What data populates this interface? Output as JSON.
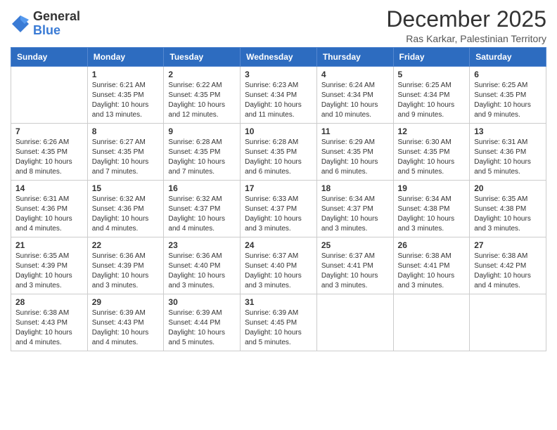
{
  "logo": {
    "general": "General",
    "blue": "Blue"
  },
  "title": "December 2025",
  "location": "Ras Karkar, Palestinian Territory",
  "days_of_week": [
    "Sunday",
    "Monday",
    "Tuesday",
    "Wednesday",
    "Thursday",
    "Friday",
    "Saturday"
  ],
  "weeks": [
    [
      {
        "day": "",
        "info": ""
      },
      {
        "day": "1",
        "info": "Sunrise: 6:21 AM\nSunset: 4:35 PM\nDaylight: 10 hours\nand 13 minutes."
      },
      {
        "day": "2",
        "info": "Sunrise: 6:22 AM\nSunset: 4:35 PM\nDaylight: 10 hours\nand 12 minutes."
      },
      {
        "day": "3",
        "info": "Sunrise: 6:23 AM\nSunset: 4:34 PM\nDaylight: 10 hours\nand 11 minutes."
      },
      {
        "day": "4",
        "info": "Sunrise: 6:24 AM\nSunset: 4:34 PM\nDaylight: 10 hours\nand 10 minutes."
      },
      {
        "day": "5",
        "info": "Sunrise: 6:25 AM\nSunset: 4:34 PM\nDaylight: 10 hours\nand 9 minutes."
      },
      {
        "day": "6",
        "info": "Sunrise: 6:25 AM\nSunset: 4:35 PM\nDaylight: 10 hours\nand 9 minutes."
      }
    ],
    [
      {
        "day": "7",
        "info": "Sunrise: 6:26 AM\nSunset: 4:35 PM\nDaylight: 10 hours\nand 8 minutes."
      },
      {
        "day": "8",
        "info": "Sunrise: 6:27 AM\nSunset: 4:35 PM\nDaylight: 10 hours\nand 7 minutes."
      },
      {
        "day": "9",
        "info": "Sunrise: 6:28 AM\nSunset: 4:35 PM\nDaylight: 10 hours\nand 7 minutes."
      },
      {
        "day": "10",
        "info": "Sunrise: 6:28 AM\nSunset: 4:35 PM\nDaylight: 10 hours\nand 6 minutes."
      },
      {
        "day": "11",
        "info": "Sunrise: 6:29 AM\nSunset: 4:35 PM\nDaylight: 10 hours\nand 6 minutes."
      },
      {
        "day": "12",
        "info": "Sunrise: 6:30 AM\nSunset: 4:35 PM\nDaylight: 10 hours\nand 5 minutes."
      },
      {
        "day": "13",
        "info": "Sunrise: 6:31 AM\nSunset: 4:36 PM\nDaylight: 10 hours\nand 5 minutes."
      }
    ],
    [
      {
        "day": "14",
        "info": "Sunrise: 6:31 AM\nSunset: 4:36 PM\nDaylight: 10 hours\nand 4 minutes."
      },
      {
        "day": "15",
        "info": "Sunrise: 6:32 AM\nSunset: 4:36 PM\nDaylight: 10 hours\nand 4 minutes."
      },
      {
        "day": "16",
        "info": "Sunrise: 6:32 AM\nSunset: 4:37 PM\nDaylight: 10 hours\nand 4 minutes."
      },
      {
        "day": "17",
        "info": "Sunrise: 6:33 AM\nSunset: 4:37 PM\nDaylight: 10 hours\nand 3 minutes."
      },
      {
        "day": "18",
        "info": "Sunrise: 6:34 AM\nSunset: 4:37 PM\nDaylight: 10 hours\nand 3 minutes."
      },
      {
        "day": "19",
        "info": "Sunrise: 6:34 AM\nSunset: 4:38 PM\nDaylight: 10 hours\nand 3 minutes."
      },
      {
        "day": "20",
        "info": "Sunrise: 6:35 AM\nSunset: 4:38 PM\nDaylight: 10 hours\nand 3 minutes."
      }
    ],
    [
      {
        "day": "21",
        "info": "Sunrise: 6:35 AM\nSunset: 4:39 PM\nDaylight: 10 hours\nand 3 minutes."
      },
      {
        "day": "22",
        "info": "Sunrise: 6:36 AM\nSunset: 4:39 PM\nDaylight: 10 hours\nand 3 minutes."
      },
      {
        "day": "23",
        "info": "Sunrise: 6:36 AM\nSunset: 4:40 PM\nDaylight: 10 hours\nand 3 minutes."
      },
      {
        "day": "24",
        "info": "Sunrise: 6:37 AM\nSunset: 4:40 PM\nDaylight: 10 hours\nand 3 minutes."
      },
      {
        "day": "25",
        "info": "Sunrise: 6:37 AM\nSunset: 4:41 PM\nDaylight: 10 hours\nand 3 minutes."
      },
      {
        "day": "26",
        "info": "Sunrise: 6:38 AM\nSunset: 4:41 PM\nDaylight: 10 hours\nand 3 minutes."
      },
      {
        "day": "27",
        "info": "Sunrise: 6:38 AM\nSunset: 4:42 PM\nDaylight: 10 hours\nand 4 minutes."
      }
    ],
    [
      {
        "day": "28",
        "info": "Sunrise: 6:38 AM\nSunset: 4:43 PM\nDaylight: 10 hours\nand 4 minutes."
      },
      {
        "day": "29",
        "info": "Sunrise: 6:39 AM\nSunset: 4:43 PM\nDaylight: 10 hours\nand 4 minutes."
      },
      {
        "day": "30",
        "info": "Sunrise: 6:39 AM\nSunset: 4:44 PM\nDaylight: 10 hours\nand 5 minutes."
      },
      {
        "day": "31",
        "info": "Sunrise: 6:39 AM\nSunset: 4:45 PM\nDaylight: 10 hours\nand 5 minutes."
      },
      {
        "day": "",
        "info": ""
      },
      {
        "day": "",
        "info": ""
      },
      {
        "day": "",
        "info": ""
      }
    ]
  ]
}
